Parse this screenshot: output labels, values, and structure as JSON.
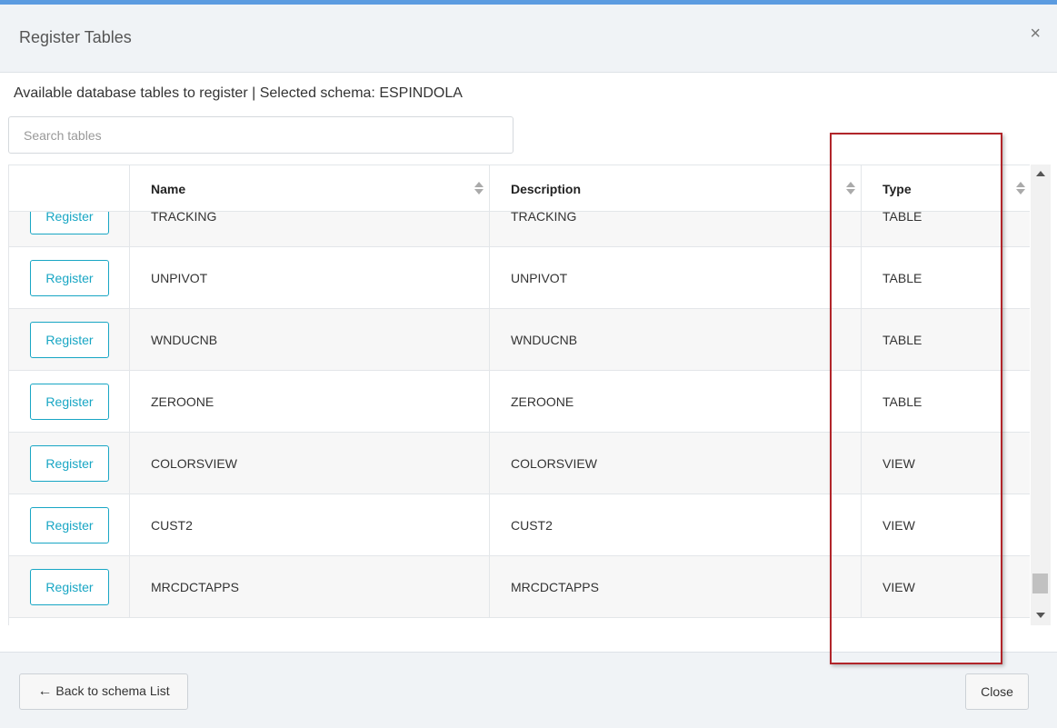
{
  "modal": {
    "title": "Register Tables",
    "close_glyph": "×",
    "subtitle": "Available database tables to register | Selected schema: ESPINDOLA"
  },
  "search": {
    "placeholder": "Search tables",
    "value": ""
  },
  "table": {
    "columns": [
      "",
      "Name",
      "Description",
      "Type"
    ],
    "register_label": "Register",
    "rows": [
      {
        "name": "TRACKING",
        "description": "TRACKING",
        "type": "TABLE"
      },
      {
        "name": "UNPIVOT",
        "description": "UNPIVOT",
        "type": "TABLE"
      },
      {
        "name": "WNDUCNB",
        "description": "WNDUCNB",
        "type": "TABLE"
      },
      {
        "name": "ZEROONE",
        "description": "ZEROONE",
        "type": "TABLE"
      },
      {
        "name": "COLORSVIEW",
        "description": "COLORSVIEW",
        "type": "VIEW"
      },
      {
        "name": "CUST2",
        "description": "CUST2",
        "type": "VIEW"
      },
      {
        "name": "MRCDCTAPPS",
        "description": "MRCDCTAPPS",
        "type": "VIEW"
      }
    ]
  },
  "footer": {
    "back_arrow": "←",
    "back_label": "Back to schema List",
    "close_label": "Close"
  },
  "colors": {
    "accent": "#18a6c4",
    "highlight_box": "#b1252a",
    "top_bar": "#5b9be0"
  },
  "icons": [
    "close-icon",
    "sort-icon",
    "arrow-left-icon",
    "scroll-up-icon",
    "scroll-down-icon"
  ]
}
